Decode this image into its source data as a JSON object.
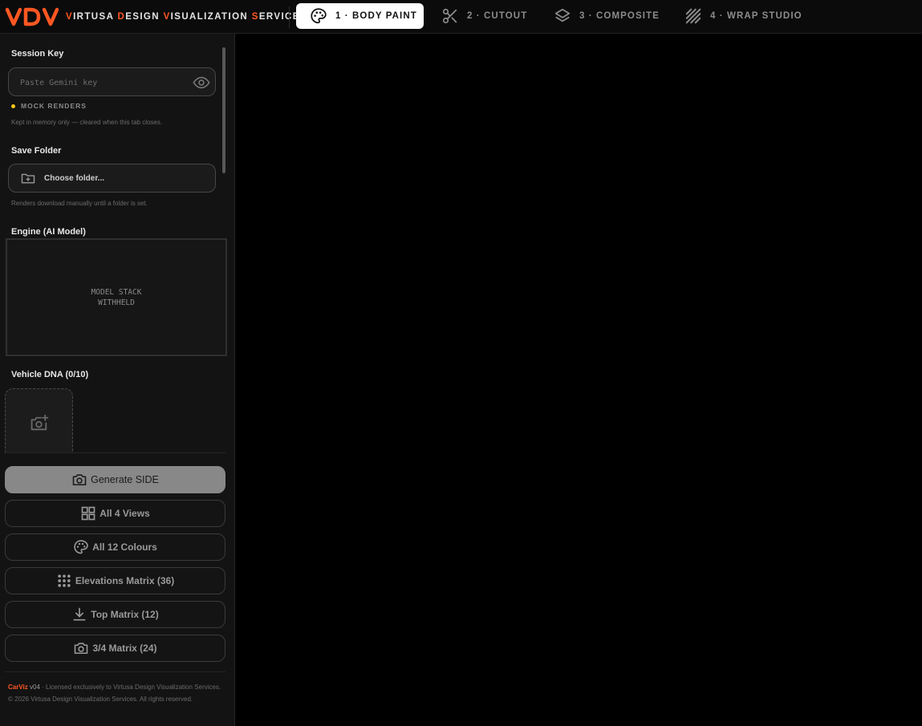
{
  "header": {
    "logo_text": "VDV",
    "brand_words": [
      {
        "cap": "V",
        "rest": "IRTUSA"
      },
      {
        "cap": "D",
        "rest": "ESIGN"
      },
      {
        "cap": "V",
        "rest": "ISUALIZATION"
      },
      {
        "cap": "S",
        "rest": "ERVICES"
      }
    ],
    "tabs": [
      {
        "label": "1 · BODY PAINT",
        "icon": "palette-icon",
        "active": true
      },
      {
        "label": "2 · CUTOUT",
        "icon": "scissors-icon",
        "active": false
      },
      {
        "label": "3 · COMPOSITE",
        "icon": "layers-icon",
        "active": false
      },
      {
        "label": "4 · WRAP STUDIO",
        "icon": "stripes-icon",
        "active": false
      }
    ]
  },
  "sidebar": {
    "session_key": {
      "label": "Session Key",
      "placeholder": "Paste Gemini key",
      "value": "",
      "status": "MOCK RENDERS",
      "hint": "Kept in memory only — cleared when this tab closes."
    },
    "save_folder": {
      "label": "Save Folder",
      "button": "Choose folder...",
      "hint": "Renders download manually until a folder is set."
    },
    "engine": {
      "label": "Engine (AI Model)",
      "line1": "MODEL STACK",
      "line2": "WITHHELD"
    },
    "vehicle_dna": {
      "label": "Vehicle DNA (0/10)"
    },
    "actions": {
      "generate": "Generate SIDE",
      "all_views": "All 4 Views",
      "all_colours": "All 12 Colours",
      "elevations": "Elevations Matrix (36)",
      "top": "Top Matrix (12)",
      "three_quarter": "3/4 Matrix (24)"
    },
    "footer": {
      "app": "CarViz",
      "version": "v04",
      "license": " · Licensed exclusively to Virtusa Design Visualization Services.",
      "copyright": "© 2026 Virtusa Design Visualization Services. All rights reserved."
    }
  },
  "colors": {
    "accent": "#ff5722",
    "status_dot": "#f5c518"
  }
}
